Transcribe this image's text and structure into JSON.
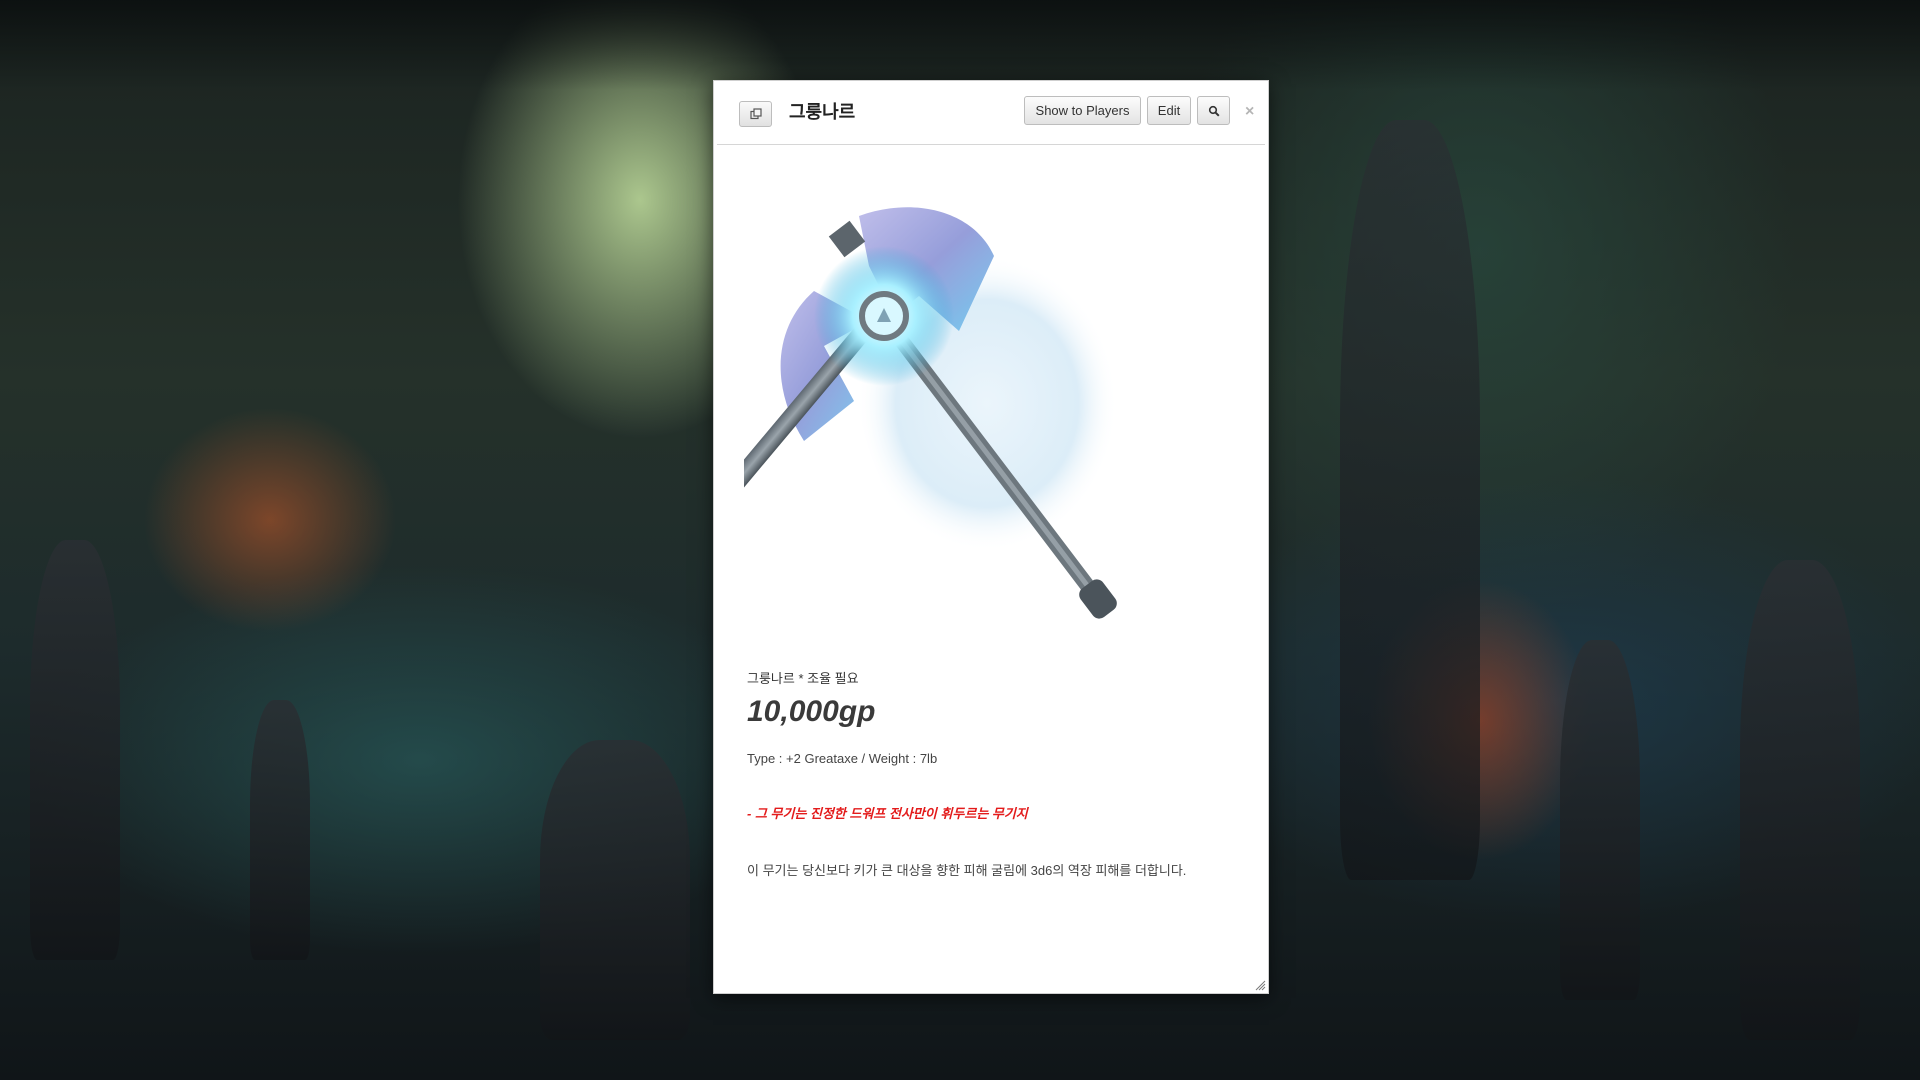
{
  "dialog": {
    "title": "그룽나르",
    "popout_icon": "popout-icon",
    "buttons": {
      "show_to_players": "Show to Players",
      "edit": "Edit",
      "search_icon": "search-icon"
    },
    "close_glyph": "×"
  },
  "item": {
    "subtitle": "그룽나르 * 조율 필요",
    "price": "10,000gp",
    "type_line": "Type : +2 Greataxe / Weight : 7lb",
    "flavor": "- 그 무기는 진정한 드워프 전사만이 휘두르는 무기지",
    "description": "이 무기는 당신보다 키가 큰 대상을 향한 피해 굴림에 3d6의 역장 피해를 더합니다."
  },
  "colors": {
    "flavor_text": "#e31b1b",
    "glow": "#7fd8ff"
  }
}
